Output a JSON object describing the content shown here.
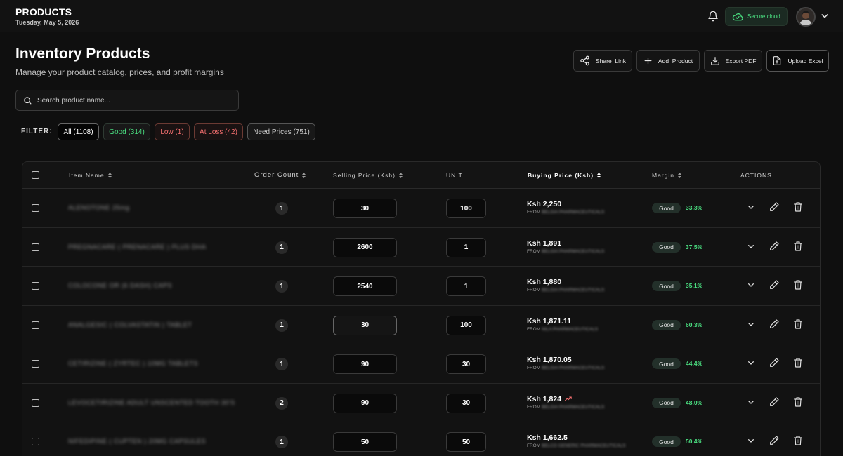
{
  "header": {
    "title": "PRODUCTS",
    "date": "Tuesday, May 5, 2026",
    "cloud_status": "Secure cloud",
    "icons": [
      "bell-icon",
      "cloud-check-icon",
      "avatar",
      "chevron-down-icon"
    ]
  },
  "page": {
    "title": "Inventory Products",
    "subtitle": "Manage your product catalog, prices, and profit margins"
  },
  "toolbar": {
    "share_label": "Share  Link",
    "add_label": "Add  Product",
    "export_label": "Export PDF",
    "upload_label": "Upload Excel"
  },
  "search": {
    "placeholder": "Search product name..."
  },
  "filter": {
    "label": "FILTER:",
    "chips": [
      "All (1108)",
      "Good (314)",
      "Low (1)",
      "At Loss (42)",
      "Need Prices (751)"
    ]
  },
  "table": {
    "columns": {
      "item_name": "Item Name",
      "order_count": "Order Count",
      "selling_price": "Selling Price (Ksh)",
      "unit": "UNIT",
      "buying_price": "Buying Price (Ksh)",
      "margin": "Margin",
      "actions": "ACTIONS"
    },
    "rows": [
      {
        "name": "ALENOTONE 25mg",
        "count": "1",
        "selling": "30",
        "unit": "100",
        "buying": "Ksh 2,250",
        "from": "FROM",
        "supplier": "BELGIA PHARMACEUTICALS",
        "status": "Good",
        "margin": "33.3%",
        "trend": false
      },
      {
        "name": "PREGNACARE ( PRENACARE ) PLUS DHA",
        "count": "1",
        "selling": "2600",
        "unit": "1",
        "buying": "Ksh 1,891",
        "from": "FROM",
        "supplier": "BELGIA PHARMACEUTICALS",
        "status": "Good",
        "margin": "37.5%",
        "trend": false
      },
      {
        "name": "COLOCONE OR (6 DASH) CAPS",
        "count": "1",
        "selling": "2540",
        "unit": "1",
        "buying": "Ksh 1,880",
        "from": "FROM",
        "supplier": "BELGIA PHARMACEUTICALS",
        "status": "Good",
        "margin": "35.1%",
        "trend": false
      },
      {
        "name": "ANALGESIC ( COLVASTATIN ) TABLET",
        "count": "1",
        "selling": "30",
        "unit": "100",
        "buying": "Ksh 1,871.11",
        "from": "FROM",
        "supplier": "NILA PHARMACEUTICALS",
        "status": "Good",
        "margin": "60.3%",
        "trend": false
      },
      {
        "name": "CETIRIZINE ( ZYRTEC ) 10MG TABLETS",
        "count": "1",
        "selling": "90",
        "unit": "30",
        "buying": "Ksh 1,870.05",
        "from": "FROM",
        "supplier": "BELGIA PHARMACEUTICALS",
        "status": "Good",
        "margin": "44.4%",
        "trend": false
      },
      {
        "name": "LEVOCETIRIZINE ADULT UNSCENTED TOOTH 30'S",
        "count": "2",
        "selling": "90",
        "unit": "30",
        "buying": "Ksh 1,824",
        "from": "FROM",
        "supplier": "BELGIA PHARMACEUTICALS",
        "status": "Good",
        "margin": "48.0%",
        "trend": true
      },
      {
        "name": "NIFEDIPINE ( CUPTEN ) 20MG CAPSULES",
        "count": "1",
        "selling": "50",
        "unit": "50",
        "buying": "Ksh 1,662.5",
        "from": "FROM",
        "supplier": "BELCO GENERIC PHARMACEUTICALS",
        "status": "Good",
        "margin": "50.4%",
        "trend": false
      }
    ]
  },
  "colors": {
    "background": "#0f0f0f",
    "accent_green": "#4ade80",
    "danger_red": "#f87171"
  }
}
